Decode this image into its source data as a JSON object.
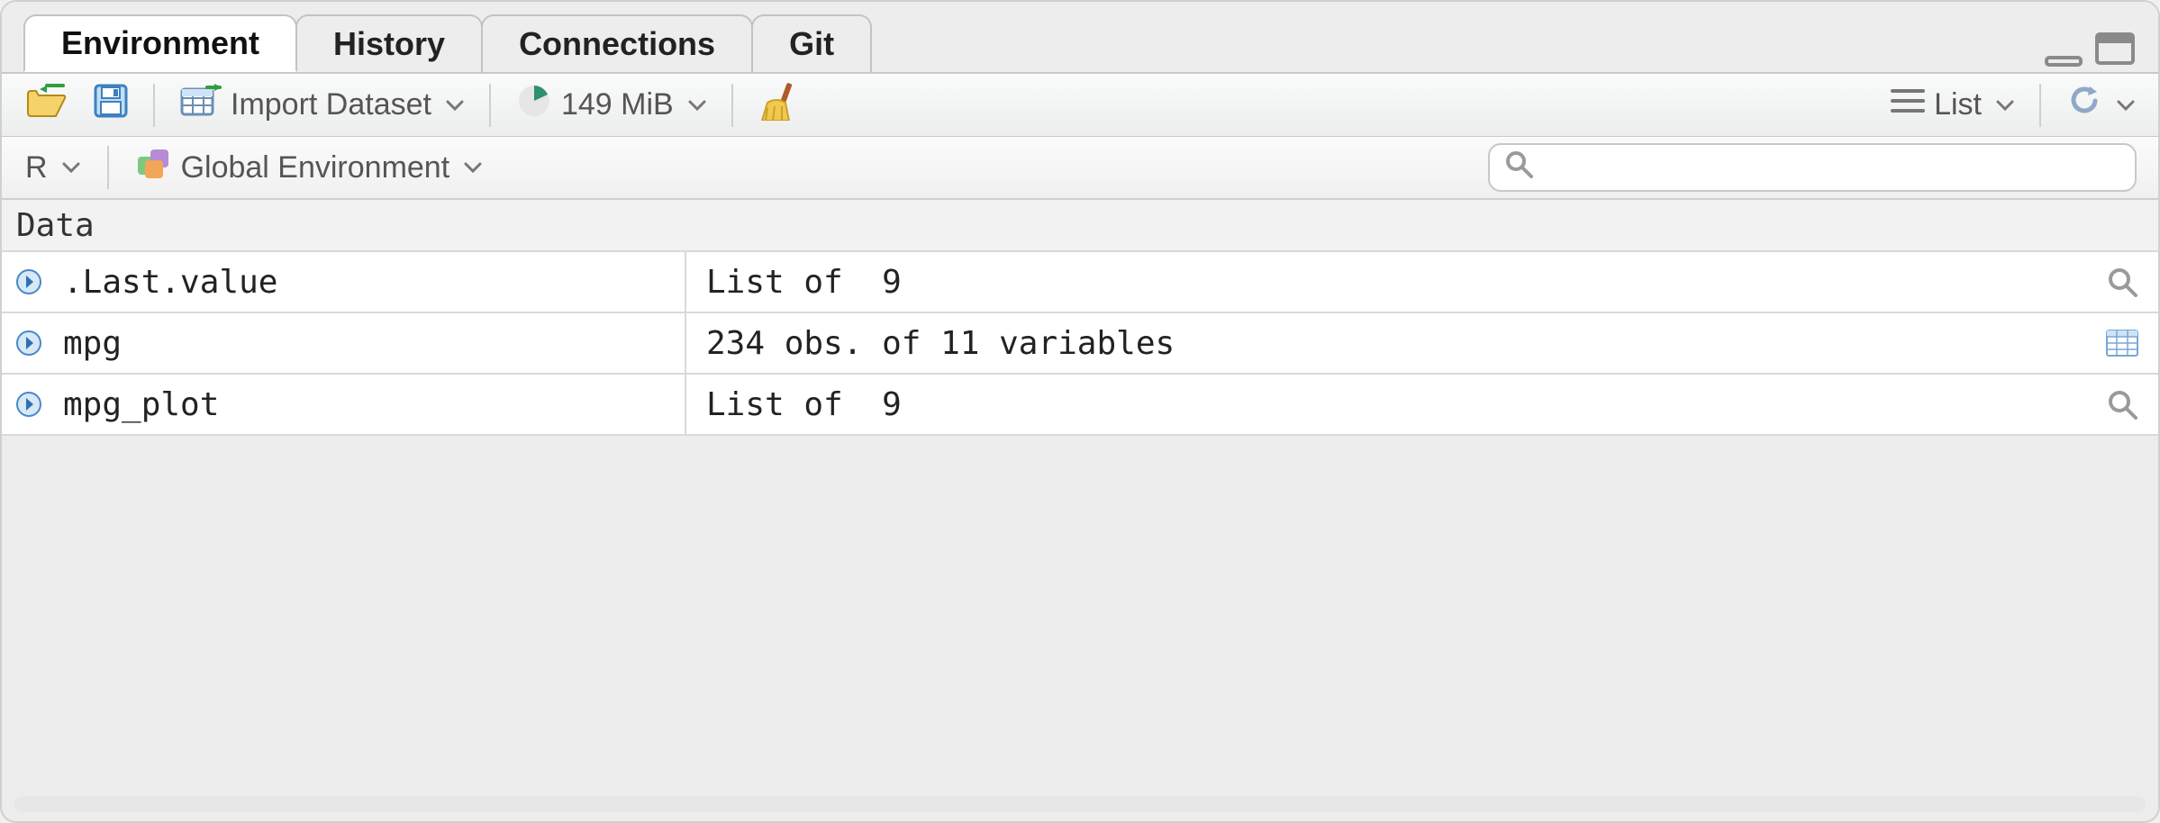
{
  "tabs": [
    {
      "label": "Environment",
      "active": true
    },
    {
      "label": "History",
      "active": false
    },
    {
      "label": "Connections",
      "active": false
    },
    {
      "label": "Git",
      "active": false
    }
  ],
  "toolbar": {
    "import_label": "Import Dataset",
    "memory_label": "149 MiB",
    "view_mode_label": "List"
  },
  "subtoolbar": {
    "language_label": "R",
    "scope_label": "Global Environment",
    "search_placeholder": ""
  },
  "section_header": "Data",
  "data_rows": [
    {
      "name": ".Last.value",
      "desc": "List of  9",
      "action": "inspect"
    },
    {
      "name": "mpg",
      "desc": "234 obs. of 11 variables",
      "action": "view-grid"
    },
    {
      "name": "mpg_plot",
      "desc": "List of  9",
      "action": "inspect"
    }
  ]
}
